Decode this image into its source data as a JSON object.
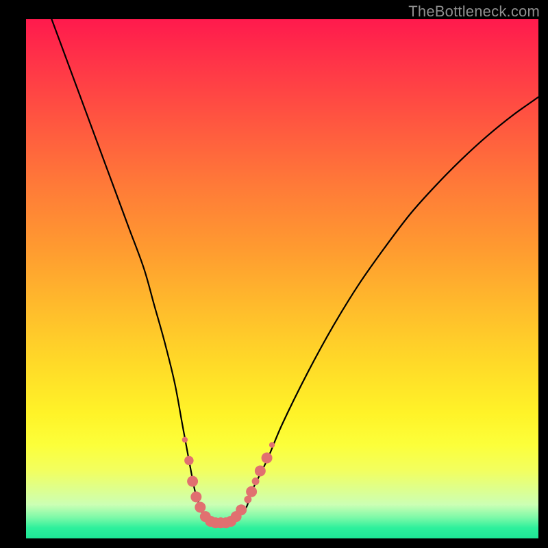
{
  "watermark": "TheBottleneck.com",
  "chart_data": {
    "type": "line",
    "title": "",
    "xlabel": "",
    "ylabel": "",
    "xlim": [
      0,
      100
    ],
    "ylim": [
      0,
      100
    ],
    "series": [
      {
        "name": "bottleneck-curve",
        "x": [
          5,
          8,
          11,
          14,
          17,
          20,
          23,
          25,
          27,
          29,
          30.5,
          32,
          33,
          34,
          35,
          37,
          39,
          41,
          43,
          44,
          47,
          50,
          55,
          60,
          65,
          70,
          75,
          80,
          85,
          90,
          95,
          100
        ],
        "values": [
          100,
          92,
          84,
          76,
          68,
          60,
          52,
          45,
          38,
          30,
          22,
          14,
          9,
          6,
          4,
          3,
          3,
          4,
          6,
          9,
          15,
          22,
          32,
          41,
          49,
          56,
          62.5,
          68,
          73,
          77.5,
          81.5,
          85
        ]
      }
    ],
    "markers": {
      "name": "highlighted-points",
      "color": "#e17070",
      "points": [
        {
          "x": 31.0,
          "y": 19.0,
          "r": 1.0
        },
        {
          "x": 31.8,
          "y": 15.0,
          "r": 1.6
        },
        {
          "x": 32.5,
          "y": 11.0,
          "r": 1.9
        },
        {
          "x": 33.2,
          "y": 8.0,
          "r": 1.9
        },
        {
          "x": 34.0,
          "y": 6.0,
          "r": 1.9
        },
        {
          "x": 35.0,
          "y": 4.2,
          "r": 1.9
        },
        {
          "x": 36.0,
          "y": 3.3,
          "r": 1.9
        },
        {
          "x": 37.0,
          "y": 3.0,
          "r": 1.9
        },
        {
          "x": 38.0,
          "y": 3.0,
          "r": 1.9
        },
        {
          "x": 39.0,
          "y": 3.0,
          "r": 1.9
        },
        {
          "x": 40.0,
          "y": 3.3,
          "r": 1.9
        },
        {
          "x": 41.0,
          "y": 4.2,
          "r": 1.9
        },
        {
          "x": 42.0,
          "y": 5.5,
          "r": 1.9
        },
        {
          "x": 43.3,
          "y": 7.5,
          "r": 1.3
        },
        {
          "x": 44.0,
          "y": 9.0,
          "r": 1.9
        },
        {
          "x": 44.8,
          "y": 11.0,
          "r": 1.3
        },
        {
          "x": 45.7,
          "y": 13.0,
          "r": 1.9
        },
        {
          "x": 47.0,
          "y": 15.5,
          "r": 1.9
        },
        {
          "x": 48.0,
          "y": 18.0,
          "r": 1.0
        }
      ]
    },
    "background_gradient": {
      "stops": [
        {
          "pos": 0,
          "color": "#ff1a4d"
        },
        {
          "pos": 8,
          "color": "#ff3348"
        },
        {
          "pos": 20,
          "color": "#ff5740"
        },
        {
          "pos": 32,
          "color": "#ff7a38"
        },
        {
          "pos": 44,
          "color": "#ff9a30"
        },
        {
          "pos": 55,
          "color": "#ffba2c"
        },
        {
          "pos": 66,
          "color": "#ffd928"
        },
        {
          "pos": 76,
          "color": "#fff328"
        },
        {
          "pos": 82,
          "color": "#fcff3a"
        },
        {
          "pos": 87,
          "color": "#f2ff60"
        },
        {
          "pos": 93.5,
          "color": "#ccffb4"
        },
        {
          "pos": 96,
          "color": "#7cf9a8"
        },
        {
          "pos": 98,
          "color": "#2df09c"
        },
        {
          "pos": 100,
          "color": "#1ee896"
        }
      ]
    }
  }
}
